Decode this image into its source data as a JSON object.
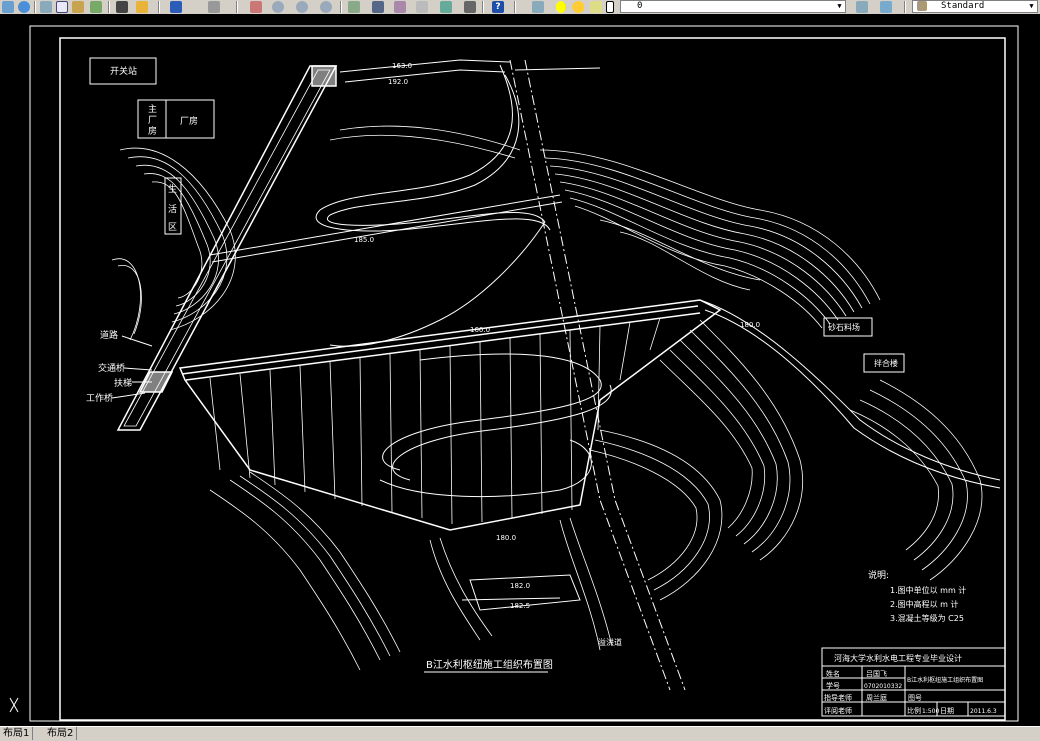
{
  "toolbar": {
    "layer_name": "0",
    "text_style": "Standard"
  },
  "drawing": {
    "switch_station": "开关站",
    "main_powerhouse_chars": [
      "主",
      "厂",
      "房"
    ],
    "plant_label": "厂房",
    "living_area_chars": [
      "生",
      "活",
      "区"
    ],
    "road_label": "道路",
    "traffic_bridge": "交通桥",
    "stair": "扶梯",
    "work_bridge": "工作桥",
    "aggregate_plant": "砂石料场",
    "concrete_plant": "拌合楼",
    "spillway": "溢洪道",
    "title": "B江水利枢纽施工组织布置图",
    "notes_title": "说明:",
    "notes": [
      "1.图中单位以 mm 计",
      "2.图中高程以 m 计",
      "3.混凝土等级为 C25"
    ],
    "elevations": [
      "192.0",
      "163.0",
      "185.0",
      "160.0",
      "180.0",
      "182.0",
      "182.5",
      "180.0"
    ]
  },
  "title_block": {
    "university": "河海大学水利水电工程专业毕业设计",
    "name_label": "姓名",
    "name_value": "吕国飞",
    "id_label": "学号",
    "id_value": "0702010332",
    "drawing_title": "B江水利枢纽施工组织布置图",
    "advisor_label": "指导老师",
    "advisor_value": "周兰庭",
    "figno_label": "图号",
    "reviewer_label": "评阅老师",
    "scale_label": "比例",
    "scale_value": "1:500",
    "date_label": "日期",
    "date_value": "2011.6.3"
  },
  "tabs": [
    "布局1",
    "布局2"
  ]
}
